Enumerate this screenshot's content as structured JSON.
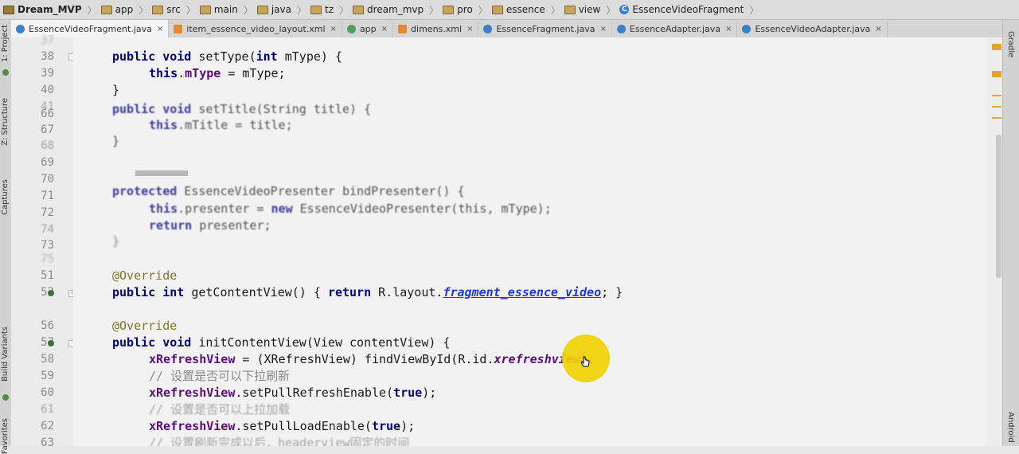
{
  "breadcrumb": [
    {
      "label": "Dream_MVP",
      "icon": "project-icon"
    },
    {
      "label": "app",
      "icon": "folder-icon"
    },
    {
      "label": "src",
      "icon": "folder-icon"
    },
    {
      "label": "main",
      "icon": "folder-icon"
    },
    {
      "label": "java",
      "icon": "folder-icon"
    },
    {
      "label": "tz",
      "icon": "folder-icon"
    },
    {
      "label": "dream_mvp",
      "icon": "folder-icon"
    },
    {
      "label": "pro",
      "icon": "folder-icon"
    },
    {
      "label": "essence",
      "icon": "folder-icon"
    },
    {
      "label": "view",
      "icon": "folder-icon"
    },
    {
      "label": "EssenceVideoFragment",
      "icon": "class-icon"
    }
  ],
  "tabs": [
    {
      "label": "EssenceVideoFragment.java",
      "icon": "java-class-icon",
      "active": true
    },
    {
      "label": "item_essence_video_layout.xml",
      "icon": "xml-file-icon",
      "active": false
    },
    {
      "label": "app",
      "icon": "app-module-icon",
      "active": false
    },
    {
      "label": "dimens.xml",
      "icon": "xml-file-icon",
      "active": false
    },
    {
      "label": "EssenceFragment.java",
      "icon": "java-class-icon",
      "active": false
    },
    {
      "label": "EssenceAdapter.java",
      "icon": "java-class-icon",
      "active": false
    },
    {
      "label": "EssenceVideoAdapter.java",
      "icon": "java-class-icon",
      "active": false
    }
  ],
  "tab_close_glyph": "×",
  "tab_menu_glyph": "≡",
  "left_tools": [
    "1: Project",
    "Z: Structure",
    "Captures",
    "Build Variants",
    "Favorites"
  ],
  "right_tools": [
    "Gradle",
    "Android"
  ],
  "line_numbers": [
    "37",
    "38",
    "39",
    "40",
    "41",
    "66",
    "67",
    "68",
    "69",
    "70",
    "71",
    "72",
    "73",
    "74",
    "75",
    "51",
    "52",
    "56",
    "57",
    "58",
    "59",
    "60",
    "61",
    "62",
    "63"
  ],
  "code": {
    "l38": {
      "kw1": "public void ",
      "t1": "setType(",
      "kw2": "int ",
      "t2": "mType) {"
    },
    "l39": {
      "kw1": "this",
      "t1": ".",
      "f1": "mType",
      "t2": " = mType;"
    },
    "l40": {
      "t1": "}"
    },
    "l41": {
      "kw1": "public void ",
      "t1": "setTitle(String title) {"
    },
    "l67": {
      "kw1": "this",
      "t1": ".mTitle = title;"
    },
    "l68": {
      "t1": "}"
    },
    "l71": {
      "kw1": "protected ",
      "t1": "EssenceVideoPresenter bindPresenter() {"
    },
    "l72": {
      "kw1": "this",
      "t1": ".presenter = ",
      "kw2": "new ",
      "t2": "EssenceVideoPresenter(this, mType);"
    },
    "l73": {
      "kw1": "return ",
      "t1": "presenter;"
    },
    "l74": {
      "t1": "}"
    },
    "l51": {
      "ann": "@Override"
    },
    "l52": {
      "kw1": "public int ",
      "t1": "getContentView() { ",
      "kw2": "return ",
      "t2": "R.layout.",
      "link": "fragment_essence_video",
      "t3": "; }"
    },
    "l56": {
      "ann": "@Override"
    },
    "l57": {
      "kw1": "public void ",
      "t1": "initContentView(View contentView) {"
    },
    "l58": {
      "f1": "xRefreshView",
      "t1": " = (XRefreshView) findViewById(R.id.",
      "f2": "xrefreshview",
      "t2": ");"
    },
    "l59": {
      "cm": "// 设置是否可以下拉刷新"
    },
    "l60": {
      "f1": "xRefreshView",
      "t1": ".setPullRefreshEnable(",
      "kw1": "true",
      "t2": ");"
    },
    "l61": {
      "cm": "// 设置是否可以上拉加载"
    },
    "l62": {
      "f1": "xRefreshView",
      "t1": ".setPullLoadEnable(",
      "kw1": "true",
      "t2": ");"
    },
    "l63": {
      "cm": "// 设置刷新完成以后，headerview固定的时间"
    }
  }
}
